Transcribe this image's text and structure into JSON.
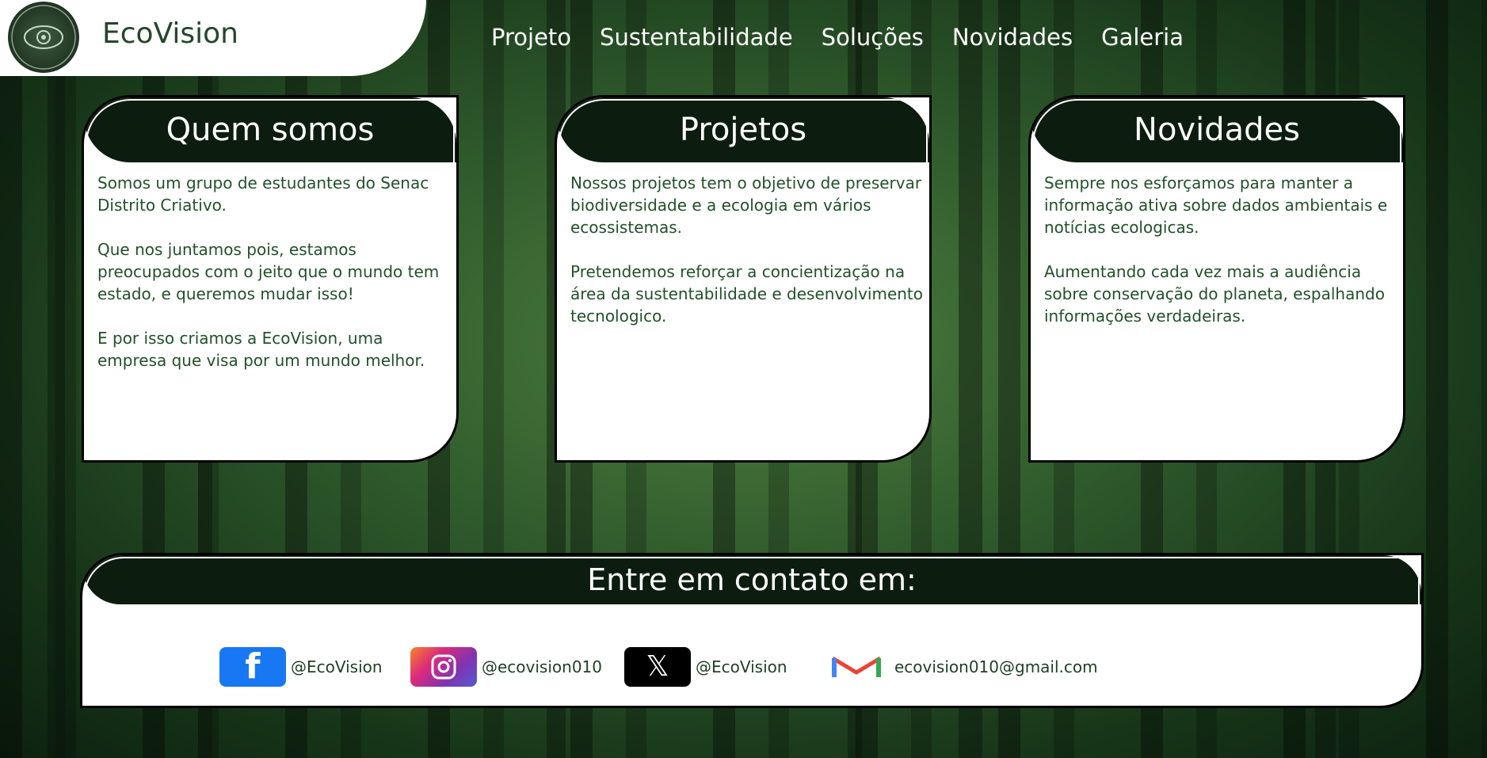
{
  "header": {
    "brand": "EcoVision"
  },
  "nav": [
    "Projeto",
    "Sustentabilidade",
    "Soluções",
    "Novidades",
    "Galeria"
  ],
  "cards": [
    {
      "title": "Quem somos",
      "paragraphs": [
        "Somos um grupo de estudantes do Senac Distrito Criativo.",
        "Que nos juntamos pois, estamos preocupados com o jeito que o mundo tem estado, e queremos mudar isso!",
        "E por isso criamos a EcoVision, uma empresa que visa por um mundo melhor."
      ]
    },
    {
      "title": "Projetos",
      "paragraphs": [
        "Nossos projetos tem o objetivo de preservar biodiversidade e a ecologia em vários ecossistemas.",
        "Pretendemos reforçar a concientização na área da sustentabilidade e desenvolvimento tecnologico."
      ]
    },
    {
      "title": "Novidades",
      "paragraphs": [
        "Sempre nos esforçamos para manter a informação ativa sobre dados ambientais e notícias ecologicas.",
        "Aumentando cada vez mais a audiência sobre conservação do planeta, espalhando informações verdadeiras."
      ]
    }
  ],
  "contact": {
    "title": "Entre em contato em:",
    "facebook": "@EcoVision",
    "instagram": "@ecovision010",
    "x": "@EcoVision",
    "gmail": "ecovision010@gmail.com"
  },
  "colors": {
    "accent": "#23472a",
    "panel": "#0c1d0f"
  }
}
